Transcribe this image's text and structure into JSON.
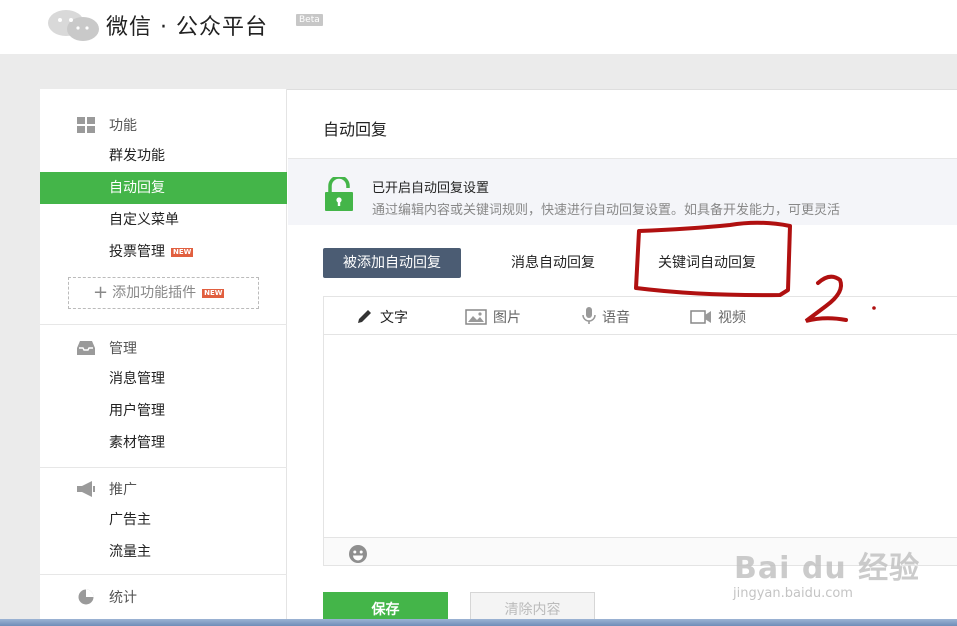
{
  "header": {
    "logo_text": "微信 · 公众平台",
    "beta_badge": "Beta"
  },
  "sidebar": {
    "groups": [
      {
        "title": "功能",
        "icon": "grid-icon"
      },
      {
        "title": "管理",
        "icon": "inbox-icon"
      },
      {
        "title": "推广",
        "icon": "megaphone-icon"
      },
      {
        "title": "统计",
        "icon": "pie-chart-icon"
      }
    ],
    "items": [
      {
        "label": "群发功能"
      },
      {
        "label": "自动回复",
        "active": true
      },
      {
        "label": "自定义菜单"
      },
      {
        "label": "投票管理",
        "badge": "NEW"
      },
      {
        "label": "消息管理"
      },
      {
        "label": "用户管理"
      },
      {
        "label": "素材管理"
      },
      {
        "label": "广告主"
      },
      {
        "label": "流量主"
      }
    ],
    "add_plugin": {
      "label": "添加功能插件",
      "badge": "NEW"
    }
  },
  "main": {
    "title": "自动回复",
    "notice": {
      "title": "已开启自动回复设置",
      "desc": "通过编辑内容或关键词规则，快速进行自动回复设置。如具备开发能力，可更灵活"
    },
    "tabs": [
      {
        "label": "被添加自动回复",
        "active": true
      },
      {
        "label": "消息自动回复"
      },
      {
        "label": "关键词自动回复"
      }
    ],
    "editor_tools": [
      {
        "label": "文字",
        "icon": "pencil-icon",
        "active": true
      },
      {
        "label": "图片",
        "icon": "image-icon"
      },
      {
        "label": "语音",
        "icon": "microphone-icon"
      },
      {
        "label": "视频",
        "icon": "video-icon"
      }
    ],
    "save_label": "保存",
    "clear_label": "清除内容"
  },
  "watermark": {
    "main": "Bai du 经验",
    "sub": "jingyan.baidu.com"
  },
  "colors": {
    "accent_green": "#44b549",
    "tab_active": "#4b5c73",
    "annotation_red": "#b01010"
  }
}
